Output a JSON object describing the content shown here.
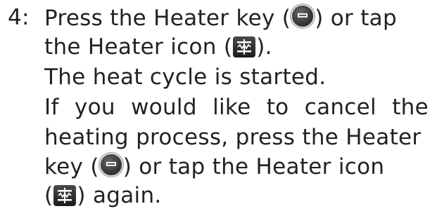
{
  "step": {
    "number": "4:",
    "line1": {
      "a": "Press the Heater key (",
      "b": ") or tap"
    },
    "line2": {
      "a": "the Heater icon (",
      "b": ")."
    },
    "line3": "The heat cycle is started.",
    "line4": [
      "If",
      "you",
      "would",
      "like",
      "to",
      "cancel",
      "the"
    ],
    "line5": "heating process, press the Heater",
    "line6": {
      "a": "key (",
      "b": ") or tap the Heater icon"
    },
    "line7": {
      "a": "(",
      "b": ") again."
    }
  },
  "icons": {
    "heater_key": "heater-key-icon",
    "heater_icon": "heater-icon"
  },
  "colors": {
    "text": "#222222",
    "icon_dark": "#1c1c1c"
  }
}
